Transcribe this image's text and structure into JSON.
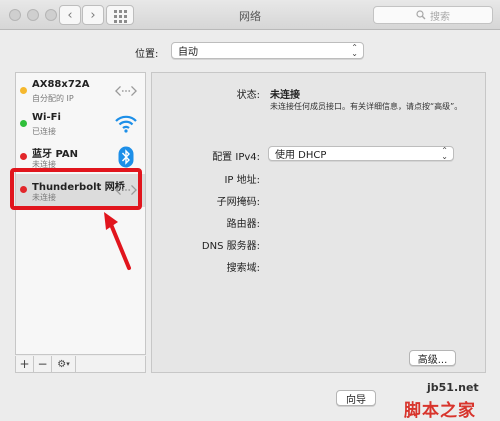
{
  "window": {
    "title": "网络",
    "search_placeholder": "搜索",
    "back_glyph": "‹",
    "forward_glyph": "›"
  },
  "location": {
    "label": "位置:",
    "value": "自动"
  },
  "services": [
    {
      "name": "AX88x72A",
      "status": "自分配的 IP",
      "dot_color": "#f5b82e",
      "icon": "ethernet-arrows-icon"
    },
    {
      "name": "Wi-Fi",
      "status": "已连接",
      "dot_color": "#2fbf3a",
      "icon": "wifi-icon"
    },
    {
      "name": "蓝牙 PAN",
      "status": "未连接",
      "dot_color": "#e2262a",
      "icon": "bluetooth-icon"
    },
    {
      "name": "Thunderbolt 网桥",
      "status": "未连接",
      "dot_color": "#e2262a",
      "icon": "ethernet-arrows-icon"
    }
  ],
  "list_tools": {
    "add": "+",
    "remove": "−",
    "gear": "⚙",
    "gear_caret": "▾"
  },
  "details": {
    "status_label": "状态:",
    "status_value": "未连接",
    "status_desc": "未连接任何成员接口。有关详细信息，请点按“高级”。",
    "ipv4_label": "配置 IPv4:",
    "ipv4_value": "使用 DHCP",
    "ip_label": "IP 地址:",
    "subnet_label": "子网掩码:",
    "router_label": "路由器:",
    "dns_label": "DNS 服务器:",
    "search_domain_label": "搜索域:",
    "advanced_button": "高级...",
    "assist_button": "向导"
  },
  "watermark": {
    "site": "jb51.net",
    "name": "脚本之家"
  },
  "colors": {
    "highlight_red": "#e1151d",
    "wifi_blue": "#1d8fe8",
    "bluetooth_blue": "#1d8fe8"
  }
}
